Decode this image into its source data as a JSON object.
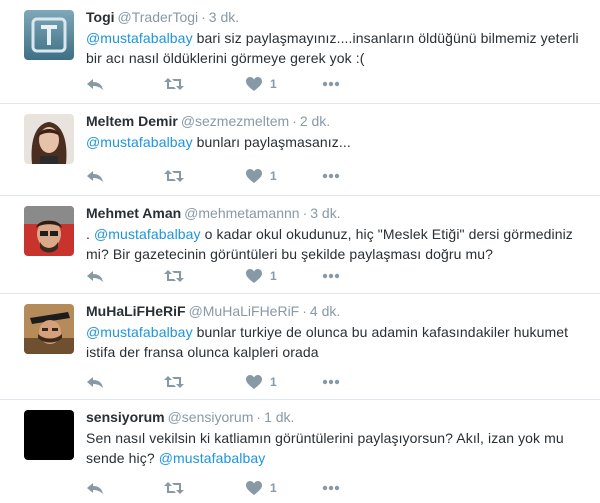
{
  "tweets": [
    {
      "fullname": "Togi",
      "username": "@TraderTogi",
      "time": "3 dk.",
      "mention": "@mustafabalbay",
      "text_before": "",
      "text_after": " bari siz paylaşmayınız....insanların öldüğünü bilmemiz yeterli bir acı nasıl öldüklerini görmeye gerek yok :(",
      "like_count": "1"
    },
    {
      "fullname": "Meltem Demir",
      "username": "@sezmezmeltem",
      "time": "2 dk.",
      "mention": "@mustafabalbay",
      "text_before": "",
      "text_after": " bunları paylaşmasanız...",
      "like_count": "1"
    },
    {
      "fullname": "Mehmet Aman",
      "username": "@mehmetamannn",
      "time": "3 dk.",
      "mention": "@mustafabalbay",
      "text_before": ". ",
      "text_after": " o kadar okul okudunuz, hiç \"Meslek Etiği\" dersi görmediniz mi? Bir gazetecinin görüntüleri bu şekilde paylaşması doğru mu?",
      "like_count": "1"
    },
    {
      "fullname": "MuHaLiFHeRiF",
      "username": "@MuHaLiFHeRiF",
      "time": "4 dk.",
      "mention": "@mustafabalbay",
      "text_before": "",
      "text_after": " bunlar turkiye de olunca bu adamin kafasındakiler hukumet istifa der fransa olunca kalpleri orada",
      "like_count": "1"
    },
    {
      "fullname": "sensiyorum",
      "username": "@sensiyorum",
      "time": "1 dk.",
      "mention": "@mustafabalbay",
      "text_before": "Sen nasıl vekilsin ki katliamın görüntülerini paylaşıyorsun? Akıl, izan yok mu sende hiç? ",
      "text_after": "",
      "like_count": "1"
    }
  ],
  "icons": {
    "reply": "reply-icon",
    "retweet": "retweet-icon",
    "like": "heart-icon",
    "more": "more-icon"
  },
  "colors": {
    "mention": "#1b95e0",
    "meta": "#8899a6",
    "text": "#292f33",
    "divider": "#e1e8ed"
  }
}
